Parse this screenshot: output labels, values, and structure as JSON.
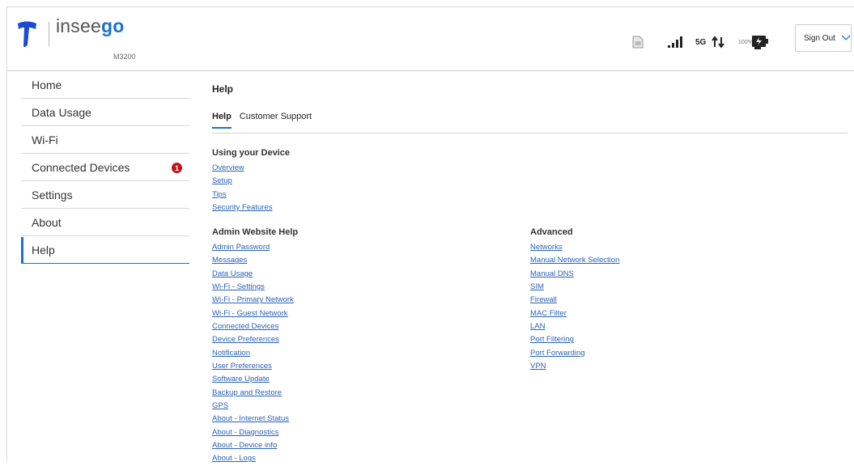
{
  "header": {
    "brand_prefix": "insee",
    "brand_suffix": "go",
    "model": "M3200",
    "network": "5G",
    "battery": "100%",
    "sign_out_label": "Sign Out"
  },
  "sidebar": {
    "items": [
      {
        "label": "Home"
      },
      {
        "label": "Data Usage"
      },
      {
        "label": "Wi-Fi"
      },
      {
        "label": "Connected Devices",
        "badge": "1"
      },
      {
        "label": "Settings"
      },
      {
        "label": "About"
      },
      {
        "label": "Help"
      }
    ]
  },
  "main": {
    "title": "Help",
    "tabs": [
      {
        "label": "Help"
      },
      {
        "label": "Customer Support"
      }
    ],
    "using_device": {
      "heading": "Using your Device",
      "links": [
        "Overview",
        "Setup",
        "Tips",
        "Security Features"
      ]
    },
    "admin_help": {
      "heading": "Admin Website Help",
      "links": [
        "Admin Password",
        "Messages",
        "Data Usage",
        "Wi-Fi - Settings",
        "Wi-Fi - Primary Network",
        "Wi-Fi - Guest Network",
        "Connected Devices",
        "Device Preferences",
        "Notification",
        "User Preferences",
        "Software Update",
        "Backup and Restore",
        "GPS",
        "About - Internet Status",
        "About - Diagnostics",
        "About - Device info",
        "About - Logs"
      ]
    },
    "advanced": {
      "heading": "Advanced",
      "links": [
        "Networks",
        "Manual Network Selection",
        "Manual DNS",
        "SIM",
        "Firewall",
        "MAC Filter",
        "LAN",
        "Port Filtering",
        "Port Forwarding",
        "VPN"
      ]
    }
  },
  "colors": {
    "accent": "#1a73c8",
    "link": "#2b63b5",
    "badge": "#c0141b",
    "telstra_blue": "#1b4bd1"
  }
}
